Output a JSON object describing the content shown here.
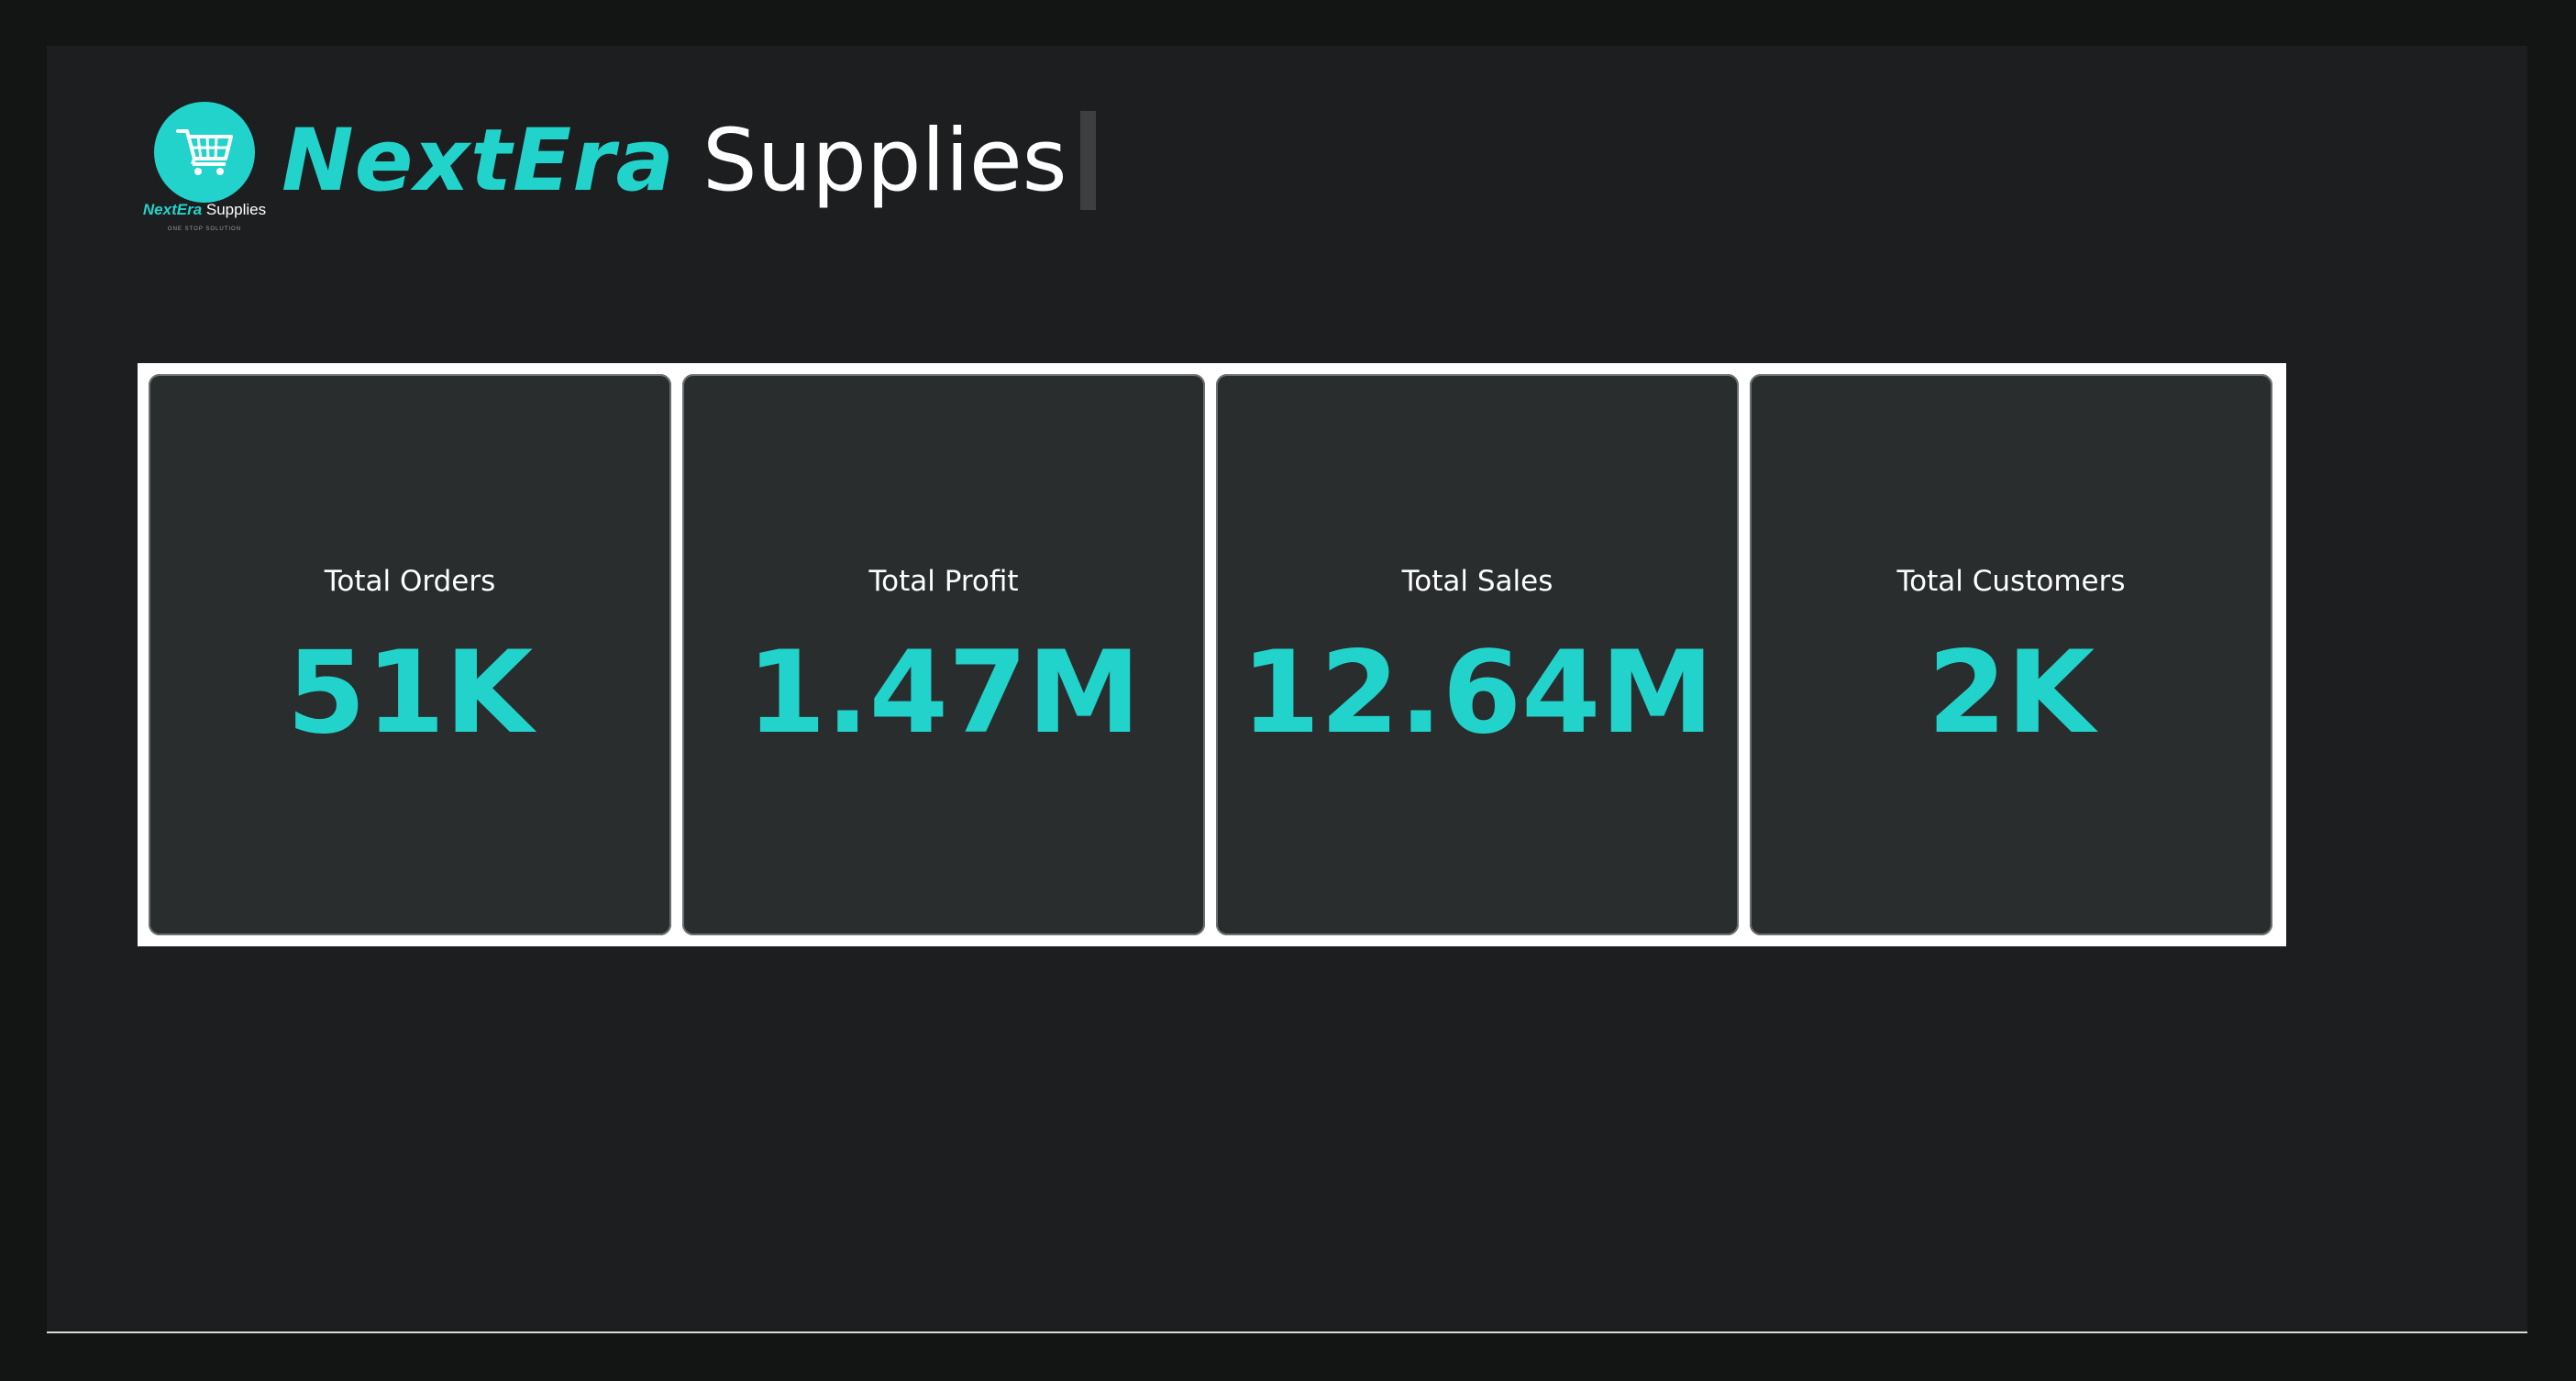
{
  "header": {
    "logo": {
      "icon": "shopping-cart-icon",
      "brand_accent": "NextEra",
      "brand_rest": "Supplies",
      "tagline": "ONE STOP SOLUTION"
    },
    "title_accent": "NextEra",
    "title_rest": "Supplies"
  },
  "cards": [
    {
      "label": "Total Orders",
      "value": "51K"
    },
    {
      "label": "Total Profit",
      "value": "1.47M"
    },
    {
      "label": "Total Sales",
      "value": "12.64M"
    },
    {
      "label": "Total Customers",
      "value": "2K"
    }
  ],
  "colors": {
    "accent": "#22d3cb",
    "background": "#1d1e20",
    "card": "#292d2e",
    "text": "#ffffff"
  }
}
